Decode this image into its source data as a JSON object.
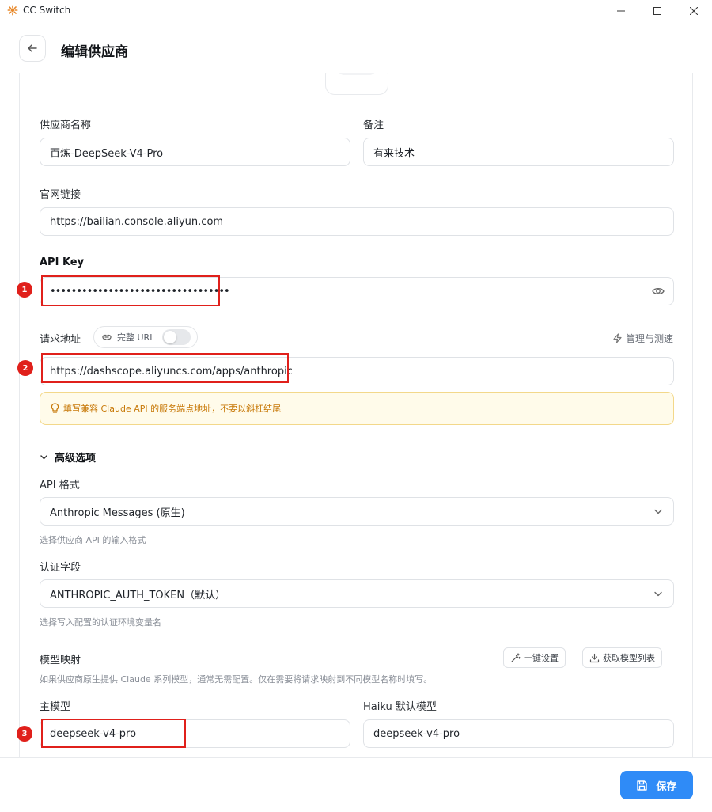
{
  "window": {
    "title": "CC Switch"
  },
  "header": {
    "title": "编辑供应商"
  },
  "form": {
    "provider_name": {
      "label": "供应商名称",
      "value": "百炼-DeepSeek-V4-Pro"
    },
    "note": {
      "label": "备注",
      "value": "有来技术"
    },
    "website": {
      "label": "官网链接",
      "value": "https://bailian.console.aliyun.com"
    },
    "api_key": {
      "label": "API Key",
      "value": "••••••••••••••••••••••••••••••••••"
    },
    "request_url": {
      "label": "请求地址",
      "full_url_toggle_label": "完整 URL",
      "manage_label": "管理与测速",
      "value": "https://dashscope.aliyuncs.com/apps/anthropic",
      "warning": "填写兼容 Claude API 的服务端点地址，不要以斜杠结尾"
    },
    "advanced": {
      "label": "高级选项",
      "api_format": {
        "label": "API 格式",
        "value": "Anthropic Messages (原生)",
        "hint": "选择供应商 API 的输入格式"
      },
      "auth_field": {
        "label": "认证字段",
        "value": "ANTHROPIC_AUTH_TOKEN（默认）",
        "hint": "选择写入配置的认证环境变量名"
      }
    },
    "model_mapping": {
      "label": "模型映射",
      "one_click_label": "一键设置",
      "fetch_models_label": "获取模型列表",
      "hint": "如果供应商原生提供 Claude 系列模型，通常无需配置。仅在需要将请求映射到不同模型名称时填写。",
      "main_model": {
        "label": "主模型",
        "value": "deepseek-v4-pro"
      },
      "haiku_model": {
        "label": "Haiku 默认模型",
        "value": "deepseek-v4-pro"
      }
    }
  },
  "annotations": [
    "1",
    "2",
    "3"
  ],
  "footer": {
    "save_label": "保存"
  },
  "colors": {
    "accent": "#2f8bf7",
    "annotation": "#e0201b",
    "warning_text": "#c87a0a",
    "warning_bg": "#fffbea"
  }
}
